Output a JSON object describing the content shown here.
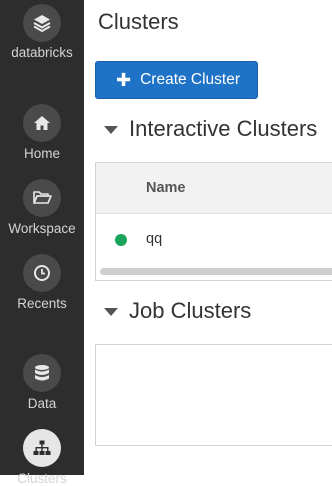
{
  "sidebar": {
    "brand_label": "databricks",
    "items": [
      {
        "label": "Home"
      },
      {
        "label": "Workspace"
      },
      {
        "label": "Recents"
      },
      {
        "label": "Data"
      },
      {
        "label": "Clusters"
      }
    ]
  },
  "page": {
    "title": "Clusters"
  },
  "toolbar": {
    "create_label": "Create Cluster",
    "create_icon": "plus-icon"
  },
  "interactive": {
    "title": "Interactive Clusters",
    "columns": [
      "Name"
    ],
    "rows": [
      {
        "name": "qq",
        "status_color": "#1aa35b"
      }
    ]
  },
  "job": {
    "title": "Job Clusters"
  },
  "colors": {
    "sidebar_bg": "#2d2d2d",
    "primary_button": "#1e73c6",
    "status_running": "#1aa35b"
  }
}
